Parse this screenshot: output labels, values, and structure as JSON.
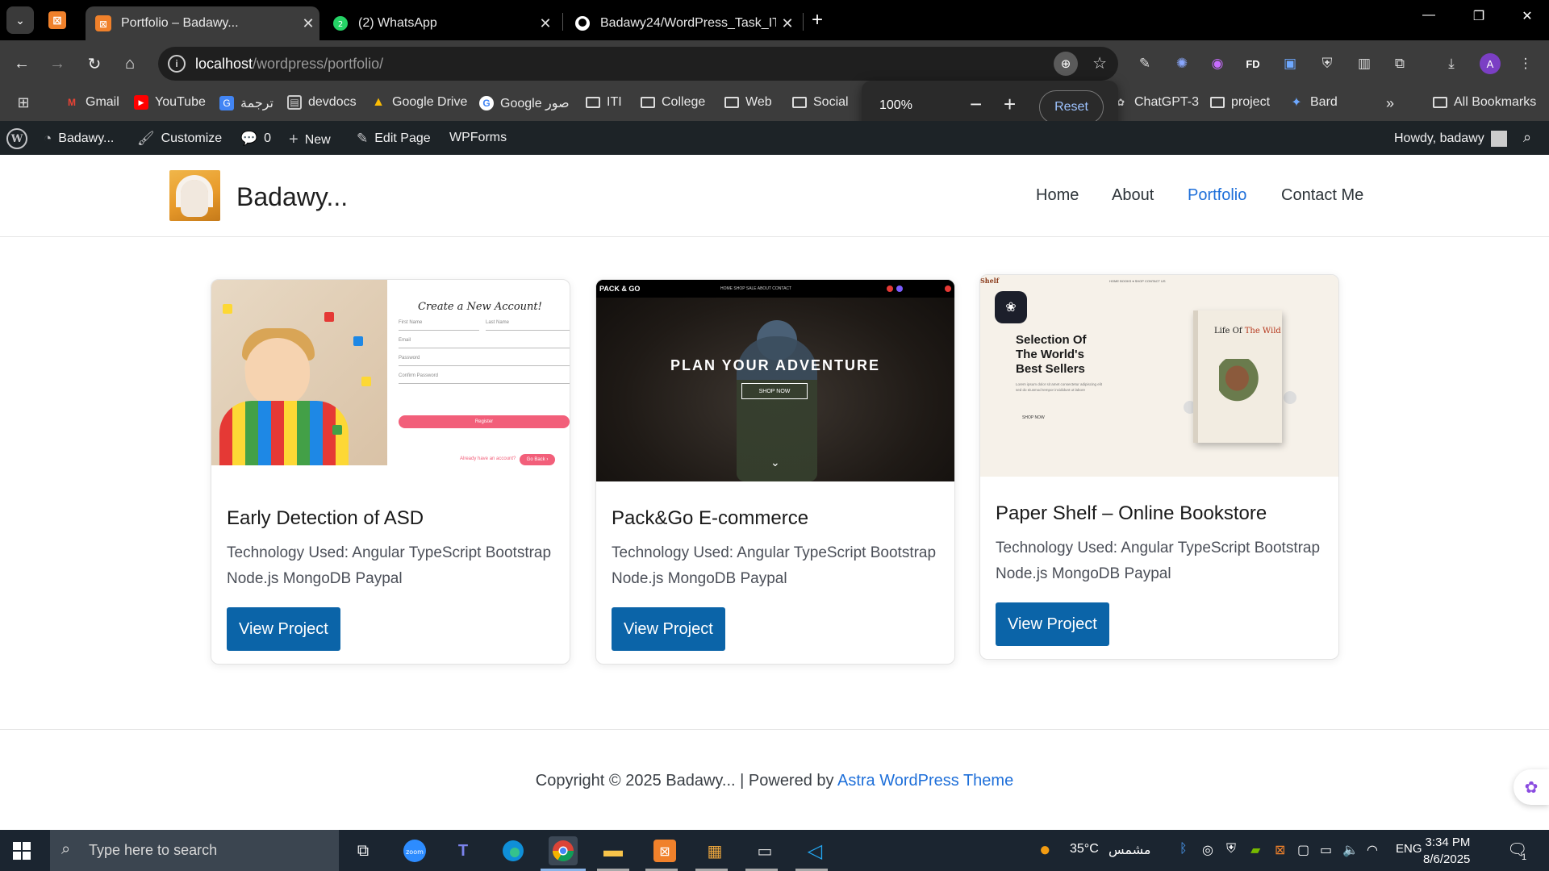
{
  "browser": {
    "tabs": [
      {
        "title": "Portfolio – Badawy...",
        "active": true
      },
      {
        "title": "(2) WhatsApp",
        "active": false
      },
      {
        "title": "Badawy24/WordPress_Task_ITI",
        "active": false
      }
    ],
    "url_host": "localhost",
    "url_path": "/wordpress/portfolio/",
    "profile_initial": "A",
    "bookmarks": [
      {
        "label": "Gmail",
        "icon": "gmail-icon"
      },
      {
        "label": "YouTube",
        "icon": "youtube-icon"
      },
      {
        "label": "ترجمة",
        "icon": "translate-icon"
      },
      {
        "label": "devdocs",
        "icon": "devdocs-icon"
      },
      {
        "label": "Google Drive",
        "icon": "drive-icon"
      },
      {
        "label": "Google صور",
        "icon": "google-icon"
      },
      {
        "label": "ITI",
        "icon": "folder-icon"
      },
      {
        "label": "College",
        "icon": "folder-icon"
      },
      {
        "label": "Web",
        "icon": "folder-icon"
      },
      {
        "label": "Social",
        "icon": "folder-icon"
      },
      {
        "label": "ChatGPT-3",
        "icon": "chatgpt-icon"
      },
      {
        "label": "project",
        "icon": "folder-icon"
      },
      {
        "label": "Bard",
        "icon": "bard-icon"
      }
    ],
    "all_bookmarks_label": "All Bookmarks",
    "zoom": {
      "level": "100%",
      "minus": "−",
      "plus": "+",
      "reset_label": "Reset"
    }
  },
  "wp_admin_bar": {
    "site_name": "Badawy...",
    "customize": "Customize",
    "comments_count": "0",
    "new": "New",
    "edit_page": "Edit Page",
    "wpforms": "WPForms",
    "howdy": "Howdy, badawy"
  },
  "site": {
    "title": "Badawy...",
    "nav": [
      {
        "label": "Home",
        "current": false
      },
      {
        "label": "About",
        "current": false
      },
      {
        "label": "Portfolio",
        "current": true
      },
      {
        "label": "Contact Me",
        "current": false
      }
    ]
  },
  "projects": [
    {
      "title": "Early Detection of ASD",
      "tech": "Technology Used: Angular TypeScript Bootstrap Node.js MongoDB Paypal",
      "button": "View Project",
      "thumb": {
        "heading": "Create a New Account!",
        "first_name": "First Name",
        "last_name": "Last Name",
        "email": "Email",
        "password": "Password",
        "confirm": "Confirm Password",
        "register": "Register",
        "already": "Already have an account?",
        "go_back": "Go Back ›"
      }
    },
    {
      "title": "Pack&Go E-commerce",
      "tech": "Technology Used: Angular TypeScript Bootstrap Node.js MongoDB Paypal",
      "button": "View Project",
      "thumb": {
        "brand": "PACK & GO",
        "menu": "HOME   SHOP   SALE   ABOUT   CONTACT",
        "headline": "PLAN YOUR ADVENTURE",
        "cta": "SHOP NOW"
      }
    },
    {
      "title": "Paper Shelf – Online Bookstore",
      "tech": "Technology Used: Angular TypeScript Bootstrap Node.js MongoDB Paypal",
      "button": "View Project",
      "thumb": {
        "brand": "Shelf",
        "menu": "HOME   BOOKS ▾   SHOP   CONTACT US",
        "headline_1": "Selection Of",
        "headline_2": "The World's",
        "headline_3": "Best Sellers",
        "blurb": "Lorem ipsum dolor sit amet consectetur adipiscing elit sed do eiusmod tempor incididunt ut labore",
        "cta": "SHOP NOW",
        "book_title_1": "Life Of ",
        "book_title_2": "The Wild"
      }
    }
  ],
  "footer": {
    "copyright": "Copyright © 2025 Badawy... | Powered by ",
    "theme_link": "Astra WordPress Theme"
  },
  "taskbar": {
    "search_placeholder": "Type here to search",
    "weather_temp": "35°C",
    "weather_text": "مشمس",
    "language": "ENG",
    "time": "3:34 PM",
    "date": "8/6/2025",
    "notification_count": "1"
  },
  "colors": {
    "accent_link": "#1e6fd9",
    "button_bg": "#0b64a8",
    "admin_bar": "#1d2327",
    "chrome_bg": "#3c3c3c"
  }
}
